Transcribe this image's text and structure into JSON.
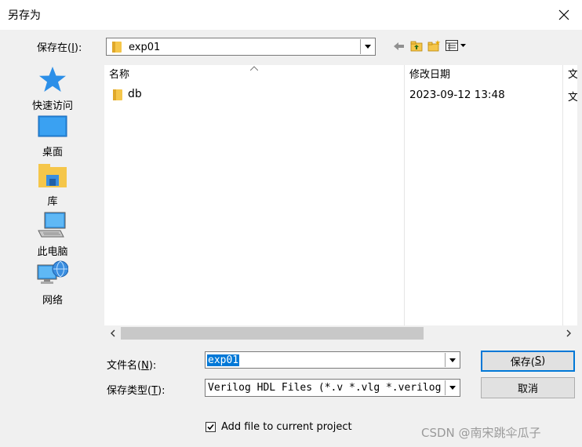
{
  "window": {
    "title": "另存为"
  },
  "location": {
    "label_prefix": "保存在(",
    "label_key": "I",
    "label_suffix": "):",
    "current_folder": "exp01"
  },
  "places": [
    {
      "label": "快速访问",
      "icon": "star-icon"
    },
    {
      "label": "桌面",
      "icon": "desktop-icon"
    },
    {
      "label": "库",
      "icon": "library-icon"
    },
    {
      "label": "此电脑",
      "icon": "computer-icon"
    },
    {
      "label": "网络",
      "icon": "network-icon"
    }
  ],
  "columns": {
    "name": "名称",
    "date": "修改日期",
    "type": "文"
  },
  "files": [
    {
      "name": "db",
      "modified": "2023-09-12 13:48",
      "type": "文"
    }
  ],
  "filename": {
    "label_prefix": "文件名(",
    "label_key": "N",
    "label_suffix": "):",
    "value": "exp01"
  },
  "filetype": {
    "label_prefix": "保存类型(",
    "label_key": "T",
    "label_suffix": "):",
    "value": "Verilog HDL Files (*.v *.vlg *.verilog"
  },
  "buttons": {
    "save_prefix": "保存(",
    "save_key": "S",
    "save_suffix": ")",
    "cancel": "取消"
  },
  "add_to_project": {
    "label": "Add file to current project",
    "checked": true
  },
  "watermark": "CSDN @南宋跳伞瓜子",
  "colors": {
    "accent": "#0078d7",
    "folder": "#f5c64a"
  }
}
